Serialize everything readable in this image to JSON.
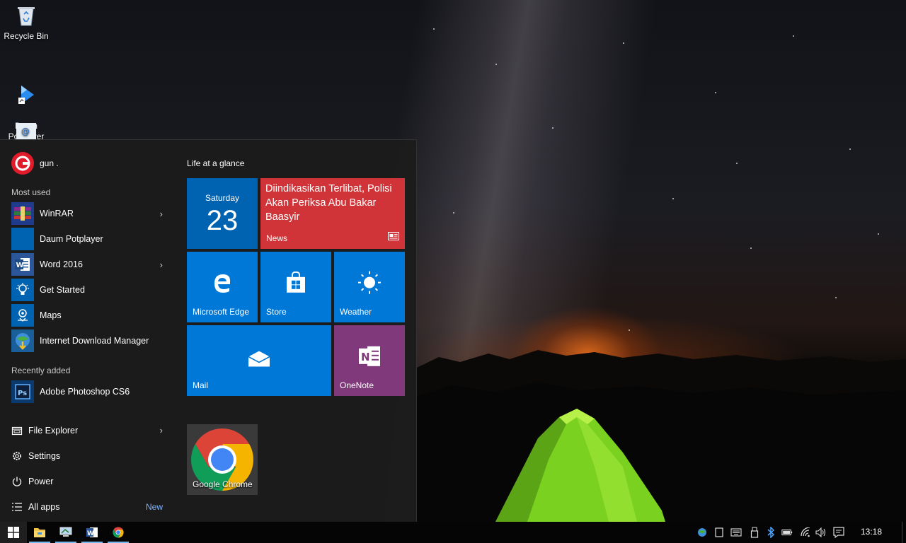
{
  "desktop": {
    "icons": [
      {
        "label": "Recycle Bin"
      },
      {
        "label": "Daum\nPotplayer"
      },
      {
        "label": ""
      }
    ]
  },
  "start_menu": {
    "user": {
      "name": "gun ."
    },
    "most_used_header": "Most used",
    "most_used": [
      {
        "label": "WinRAR",
        "has_submenu": true
      },
      {
        "label": "Daum Potplayer",
        "has_submenu": false
      },
      {
        "label": "Word 2016",
        "has_submenu": true
      },
      {
        "label": "Get Started",
        "has_submenu": false
      },
      {
        "label": "Maps",
        "has_submenu": false
      },
      {
        "label": "Internet Download Manager",
        "has_submenu": false
      }
    ],
    "recently_added_header": "Recently added",
    "recently_added": [
      {
        "label": "Adobe Photoshop CS6"
      }
    ],
    "system": {
      "file_explorer": "File Explorer",
      "settings": "Settings",
      "power": "Power",
      "all_apps": "All apps",
      "new_badge": "New"
    },
    "tiles": {
      "group_title": "Life at a glance",
      "calendar": {
        "day": "Saturday",
        "date": "23"
      },
      "news": {
        "headline": "Diindikasikan Terlibat, Polisi Akan Periksa Abu Bakar Baasyir",
        "label": "News"
      },
      "edge": {
        "label": "Microsoft Edge"
      },
      "store": {
        "label": "Store"
      },
      "weather": {
        "label": "Weather"
      },
      "mail": {
        "label": "Mail"
      },
      "onenote": {
        "label": "OneNote"
      },
      "chrome": {
        "label": "Google Chrome"
      }
    },
    "colors": {
      "tile_blue": "#0063b1",
      "news_red": "#d13438",
      "onenote_purple": "#80397b",
      "calendar_blue": "#0063b1"
    }
  },
  "taskbar": {
    "clock": "13:18"
  }
}
